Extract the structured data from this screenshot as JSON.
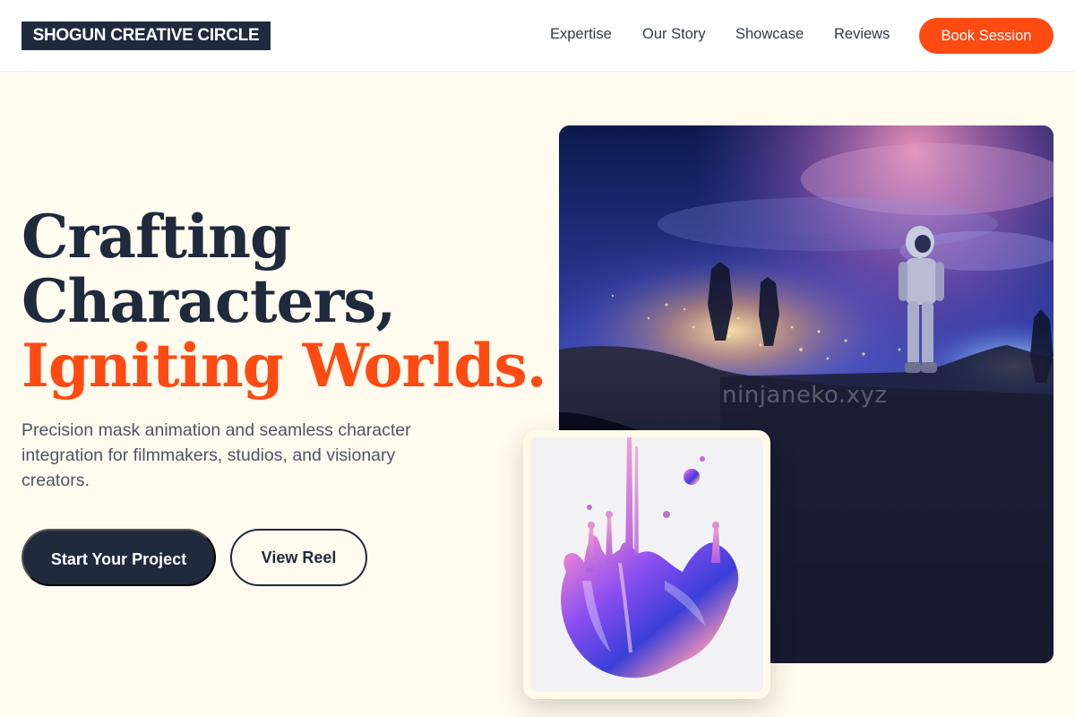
{
  "brand": {
    "logo_text": "SHOGUN CREATIVE CIRCLE"
  },
  "nav": {
    "links": [
      "Expertise",
      "Our Story",
      "Showcase",
      "Reviews"
    ],
    "cta_label": "Book Session"
  },
  "hero": {
    "headline_line1": "Crafting",
    "headline_line2": "Characters,",
    "headline_accent": "Igniting Worlds.",
    "description": "Precision mask animation and seamless character integration for filmmakers, studios, and visionary creators.",
    "primary_button": "Start Your Project",
    "secondary_button": "View Reel"
  },
  "media": {
    "main_image": "astronaut-overlooking-city-night",
    "watermark": "ninjaneko.xyz",
    "card_image": "iridescent-liquid-splash"
  },
  "colors": {
    "background": "#fffbee",
    "navy": "#1f2a3d",
    "accent": "#ff4a12",
    "white": "#ffffff"
  }
}
